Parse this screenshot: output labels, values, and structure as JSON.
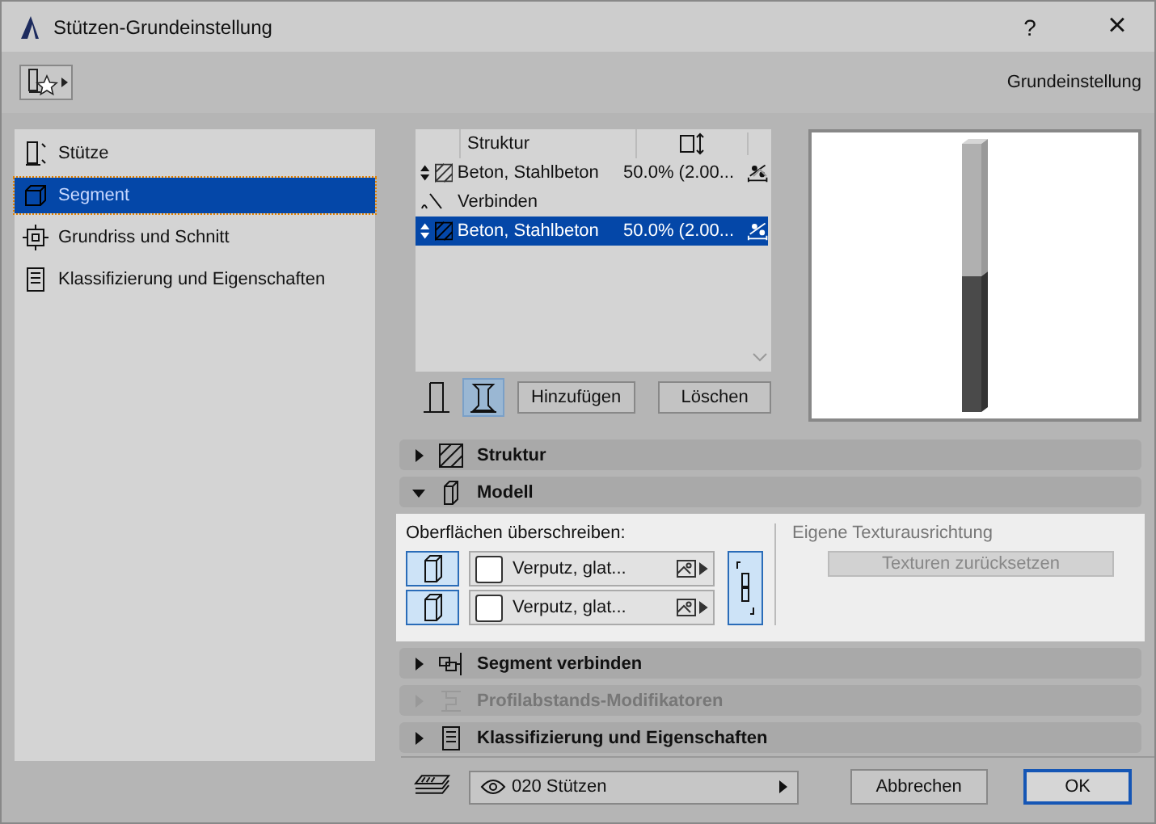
{
  "window": {
    "title": "Stützen-Grundeinstellung",
    "help": "?",
    "close": "×"
  },
  "toolbar": {
    "label": "Grundeinstellung"
  },
  "sidebar": {
    "items": [
      {
        "kind": "column",
        "label": "Stütze",
        "selected": false
      },
      {
        "kind": "segment",
        "label": "Segment",
        "selected": true
      },
      {
        "kind": "plan",
        "label": "Grundriss und Schnitt",
        "selected": false
      },
      {
        "kind": "list",
        "label": "Klassifizierung und Eigenschaften",
        "selected": false
      }
    ]
  },
  "structure": {
    "columns": [
      "Struktur"
    ],
    "rows": [
      {
        "kind": "layer",
        "material": "Beton, Stahlbeton",
        "value": "50.0% (2.00...",
        "selected": false
      },
      {
        "kind": "join",
        "label": "Verbinden",
        "selected": false
      },
      {
        "kind": "layer",
        "material": "Beton, Stahlbeton",
        "value": "50.0% (2.00...",
        "selected": true
      }
    ],
    "views": [
      {
        "kind": "plain",
        "selected": false
      },
      {
        "kind": "segmented",
        "selected": true
      }
    ],
    "buttons": [
      "Hinzufügen",
      "Löschen"
    ]
  },
  "sections": [
    {
      "kind": "structure",
      "label": "Struktur",
      "expanded": false,
      "disabled": false
    },
    {
      "kind": "model",
      "label": "Modell",
      "expanded": true,
      "disabled": false
    },
    {
      "kind": "connect",
      "label": "Segment verbinden",
      "expanded": false,
      "disabled": false
    },
    {
      "kind": "profile",
      "label": "Profilabstands-Modifikatoren",
      "expanded": false,
      "disabled": true
    },
    {
      "kind": "list",
      "label": "Klassifizierung und Eigenschaften",
      "expanded": false,
      "disabled": false
    }
  ],
  "model": {
    "surfaces_label": "Oberflächen überschreiben:",
    "surfaces": [
      {
        "value": "Verputz, glat...",
        "override": true
      },
      {
        "value": "Verputz, glat...",
        "override": true
      }
    ],
    "linked": true,
    "texture_label": "Eigene Texturausrichtung",
    "reset_button": {
      "label": "Texturen zurücksetzen",
      "disabled": true
    }
  },
  "footer": {
    "layer": "020 Stützen",
    "buttons": [
      {
        "kind": "cancel",
        "label": "Abbrechen"
      },
      {
        "kind": "ok",
        "label": "OK"
      }
    ]
  }
}
